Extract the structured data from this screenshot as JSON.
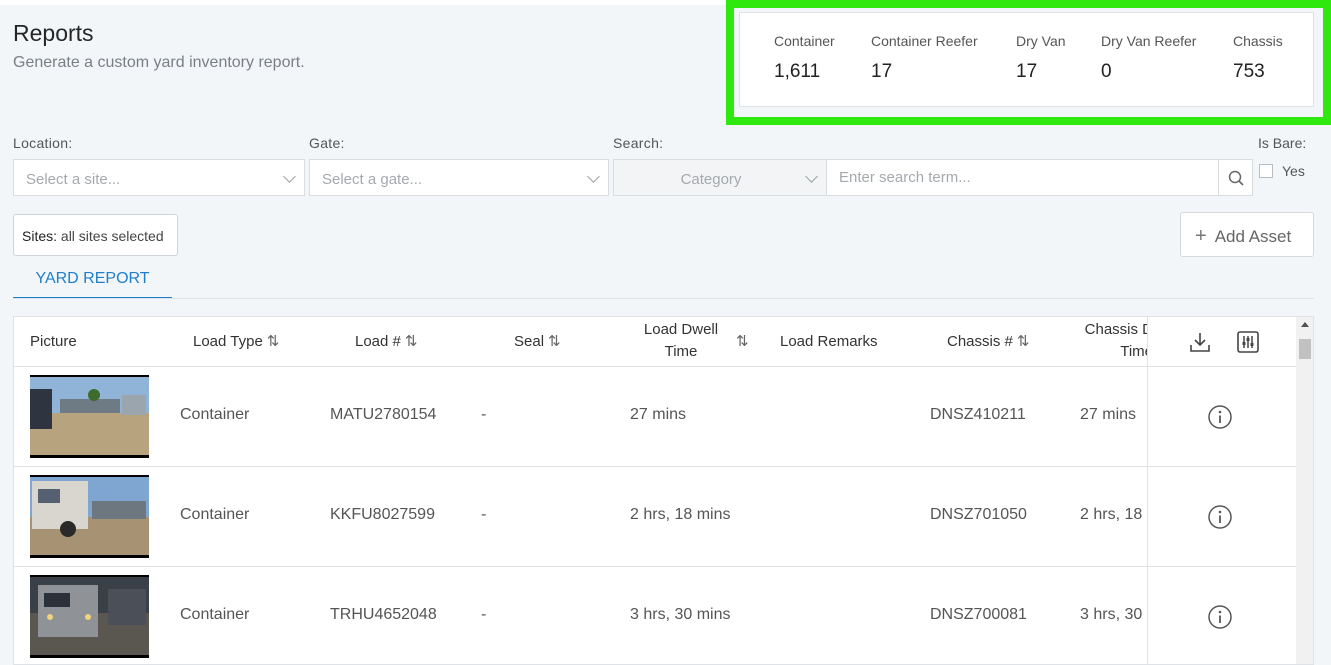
{
  "page": {
    "title": "Reports",
    "subtitle": "Generate a custom yard inventory report."
  },
  "stats": [
    {
      "label": "Container",
      "value": "1,611"
    },
    {
      "label": "Container Reefer",
      "value": "17"
    },
    {
      "label": "Dry Van",
      "value": "17"
    },
    {
      "label": "Dry Van Reefer",
      "value": "0"
    },
    {
      "label": "Chassis",
      "value": "753"
    }
  ],
  "filters": {
    "location_label": "Location:",
    "location_placeholder": "Select a site...",
    "gate_label": "Gate:",
    "gate_placeholder": "Select a gate...",
    "search_label": "Search:",
    "category_placeholder": "Category",
    "search_placeholder": "Enter search term...",
    "bare_label": "Is Bare:",
    "bare_option": "Yes"
  },
  "sites_chip": {
    "label": "Sites:",
    "value": "all sites selected"
  },
  "add_asset_label": "Add Asset",
  "tabs": [
    {
      "label": "YARD REPORT"
    }
  ],
  "table": {
    "headers": {
      "picture": "Picture",
      "load_type": "Load Type",
      "load_no": "Load #",
      "seal": "Seal",
      "load_dwell_1": "Load Dwell",
      "load_dwell_2": "Time",
      "load_remarks": "Load Remarks",
      "chassis_no": "Chassis #",
      "chassis_dwell_1": "Chassis D",
      "chassis_dwell_2": "Time"
    },
    "rows": [
      {
        "load_type": "Container",
        "load_no": "MATU2780154",
        "seal": "-",
        "load_dwell": "27 mins",
        "chassis_no": "DNSZ410211",
        "chassis_dwell": "27 mins"
      },
      {
        "load_type": "Container",
        "load_no": "KKFU8027599",
        "seal": "-",
        "load_dwell": "2 hrs, 18 mins",
        "chassis_no": "DNSZ701050",
        "chassis_dwell": "2 hrs, 18"
      },
      {
        "load_type": "Container",
        "load_no": "TRHU4652048",
        "seal": "-",
        "load_dwell": "3 hrs, 30 mins",
        "chassis_no": "DNSZ700081",
        "chassis_dwell": "3 hrs, 30"
      }
    ]
  },
  "colors": {
    "accent": "#1f7fc8",
    "highlight": "#2ee80e"
  }
}
